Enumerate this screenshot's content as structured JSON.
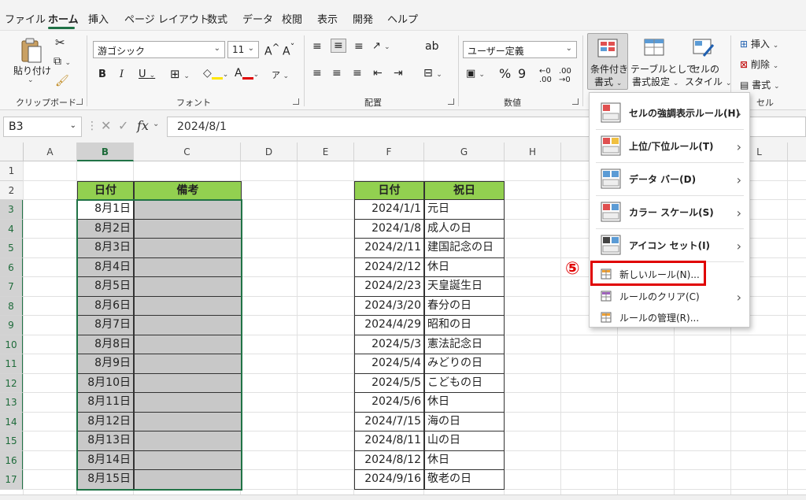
{
  "menu": {
    "tabs": [
      "ファイル",
      "ホーム",
      "挿入",
      "ページ レイアウト",
      "数式",
      "データ",
      "校閲",
      "表示",
      "開発",
      "ヘルプ"
    ],
    "active": "ホーム"
  },
  "ribbon": {
    "clipboard": {
      "paste_label": "貼り付け",
      "group_label": "クリップボード"
    },
    "font": {
      "font_name": "游ゴシック",
      "font_size": "11",
      "group_label": "フォント"
    },
    "alignment": {
      "group_label": "配置"
    },
    "number": {
      "format": "ユーザー定義",
      "group_label": "数値"
    },
    "styles": {
      "conditional_format": [
        "条件付き",
        "書式"
      ],
      "format_as_table": [
        "テーブルとして",
        "書式設定"
      ],
      "cell_styles": [
        "セルの",
        "スタイル"
      ]
    },
    "cells": {
      "insert": "挿入",
      "delete": "削除",
      "format": "書式",
      "group_label": "セル"
    }
  },
  "formula_bar": {
    "name_box": "B3",
    "fx": "fx",
    "content": "2024/8/1"
  },
  "grid": {
    "columns": [
      "A",
      "B",
      "C",
      "D",
      "E",
      "F",
      "G",
      "H"
    ],
    "columns_partial": [
      "L"
    ],
    "rows": [
      "1",
      "2",
      "3",
      "4",
      "5",
      "6",
      "7",
      "8",
      "9",
      "10",
      "11",
      "12",
      "13",
      "14",
      "15",
      "16",
      "17"
    ],
    "table1": {
      "headers": [
        "日付",
        "備考"
      ],
      "dates": [
        "8月1日",
        "8月2日",
        "8月3日",
        "8月4日",
        "8月5日",
        "8月6日",
        "8月7日",
        "8月8日",
        "8月9日",
        "8月10日",
        "8月11日",
        "8月12日",
        "8月13日",
        "8月14日",
        "8月15日"
      ]
    },
    "table2": {
      "headers": [
        "日付",
        "祝日"
      ],
      "rows": [
        [
          "2024/1/1",
          "元日"
        ],
        [
          "2024/1/8",
          "成人の日"
        ],
        [
          "2024/2/11",
          "建国記念の日"
        ],
        [
          "2024/2/12",
          "休日"
        ],
        [
          "2024/2/23",
          "天皇誕生日"
        ],
        [
          "2024/3/20",
          "春分の日"
        ],
        [
          "2024/4/29",
          "昭和の日"
        ],
        [
          "2024/5/3",
          "憲法記念日"
        ],
        [
          "2024/5/4",
          "みどりの日"
        ],
        [
          "2024/5/5",
          "こどもの日"
        ],
        [
          "2024/5/6",
          "休日"
        ],
        [
          "2024/7/15",
          "海の日"
        ],
        [
          "2024/8/11",
          "山の日"
        ],
        [
          "2024/8/12",
          "休日"
        ],
        [
          "2024/9/16",
          "敬老の日"
        ]
      ]
    }
  },
  "conditional_menu": {
    "items": [
      {
        "label": "セルの強調表示ルール(H)",
        "icon": "highlight-rules-icon"
      },
      {
        "label": "上位/下位ルール(T)",
        "icon": "top-bottom-icon"
      },
      {
        "label": "データ バー(D)",
        "icon": "data-bar-icon"
      },
      {
        "label": "カラー スケール(S)",
        "icon": "color-scale-icon"
      },
      {
        "label": "アイコン セット(I)",
        "icon": "icon-set-icon"
      },
      {
        "label": "新しいルール(N)...",
        "icon": "new-rule-icon"
      },
      {
        "label": "ルールのクリア(C)",
        "icon": "clear-rules-icon"
      },
      {
        "label": "ルールの管理(R)...",
        "icon": "manage-rules-icon"
      }
    ]
  },
  "annotation": {
    "step": "⑤",
    "color": "#e00000"
  }
}
